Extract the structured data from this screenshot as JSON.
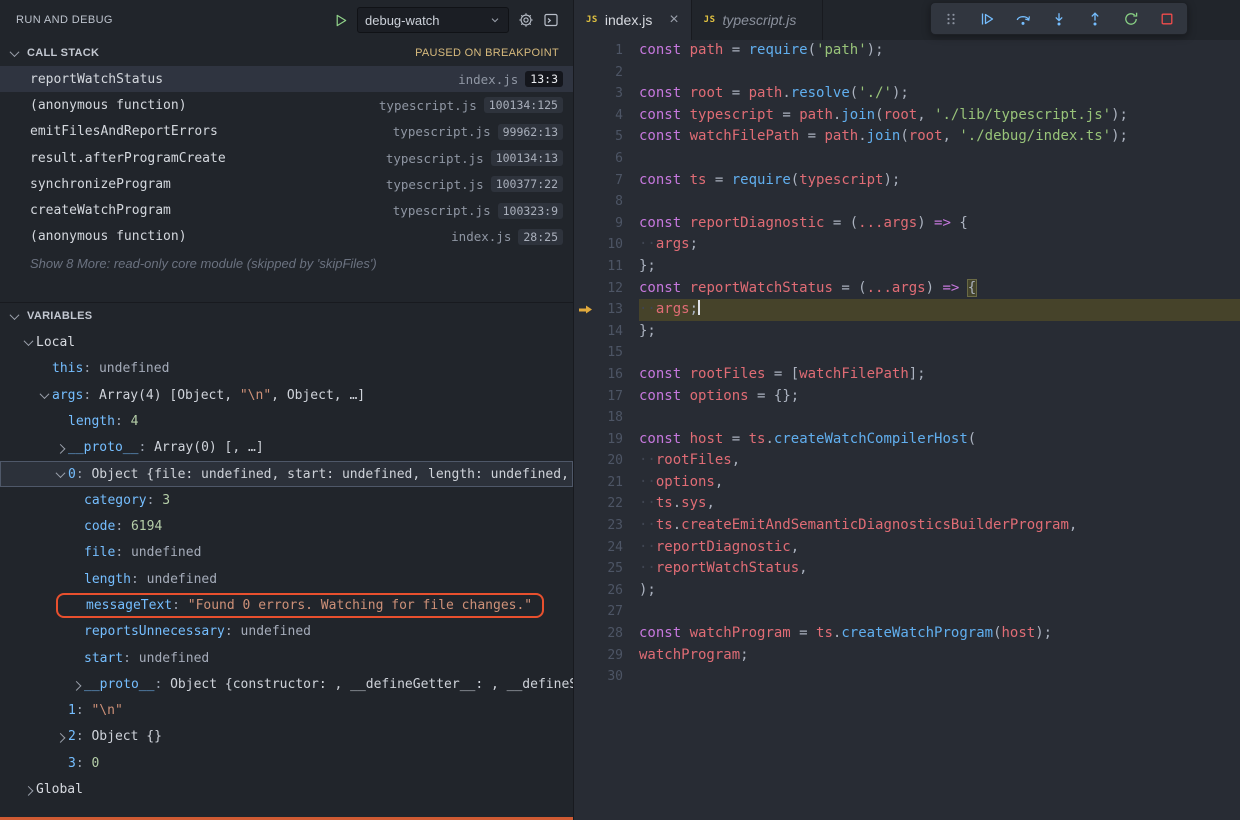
{
  "sidebar": {
    "title": "RUN AND DEBUG",
    "launch": {
      "config": "debug-watch",
      "icons": [
        "start-debug",
        "gear",
        "debug-console"
      ]
    },
    "call_stack": {
      "header": "CALL STACK",
      "status": "PAUSED ON BREAKPOINT",
      "frames": [
        {
          "name": "reportWatchStatus",
          "file": "index.js",
          "line": "13:3",
          "selected": true,
          "dark_badge": true
        },
        {
          "name": "(anonymous function)",
          "file": "typescript.js",
          "line": "100134:125"
        },
        {
          "name": "emitFilesAndReportErrors",
          "file": "typescript.js",
          "line": "99962:13"
        },
        {
          "name": "result.afterProgramCreate",
          "file": "typescript.js",
          "line": "100134:13"
        },
        {
          "name": "synchronizeProgram",
          "file": "typescript.js",
          "line": "100377:22"
        },
        {
          "name": "createWatchProgram",
          "file": "typescript.js",
          "line": "100323:9"
        },
        {
          "name": "(anonymous function)",
          "file": "index.js",
          "line": "28:25"
        }
      ],
      "more_text": "Show 8 More: read-only core module (skipped by 'skipFiles')"
    },
    "variables": {
      "header": "VARIABLES",
      "items": [
        {
          "depth": 1,
          "chevron": "down",
          "scope": "Local"
        },
        {
          "depth": 2,
          "chevron": "none",
          "name": "this",
          "value_parts": [
            [
              "undef",
              "undefined"
            ]
          ]
        },
        {
          "depth": 2,
          "chevron": "down",
          "name": "args",
          "value_parts": [
            [
              "plain",
              "Array(4) [Object, "
            ],
            [
              "str",
              "\"\\n\""
            ],
            [
              "plain",
              ", Object, …]"
            ]
          ]
        },
        {
          "depth": 3,
          "chevron": "none",
          "name": "length",
          "value_parts": [
            [
              "num",
              "4"
            ]
          ]
        },
        {
          "depth": 3,
          "chevron": "right",
          "name": "__proto__",
          "value_parts": [
            [
              "plain",
              "Array(0) [, …]"
            ]
          ]
        },
        {
          "depth": 3,
          "chevron": "down",
          "name": "0",
          "focused": true,
          "value_parts": [
            [
              "plain",
              "Object {file: undefined, start: undefined, length: undefined, …"
            ]
          ]
        },
        {
          "depth": 4,
          "chevron": "none",
          "name": "category",
          "value_parts": [
            [
              "num",
              "3"
            ]
          ]
        },
        {
          "depth": 4,
          "chevron": "none",
          "name": "code",
          "value_parts": [
            [
              "num",
              "6194"
            ]
          ]
        },
        {
          "depth": 4,
          "chevron": "none",
          "name": "file",
          "value_parts": [
            [
              "undef",
              "undefined"
            ]
          ]
        },
        {
          "depth": 4,
          "chevron": "none",
          "name": "length",
          "value_parts": [
            [
              "undef",
              "undefined"
            ]
          ]
        },
        {
          "depth": 4,
          "chevron": "none",
          "name": "messageText",
          "annotated": true,
          "value_parts": [
            [
              "str",
              "\"Found 0 errors. Watching for file changes.\""
            ]
          ]
        },
        {
          "depth": 4,
          "chevron": "none",
          "name": "reportsUnnecessary",
          "value_parts": [
            [
              "undef",
              "undefined"
            ]
          ]
        },
        {
          "depth": 4,
          "chevron": "none",
          "name": "start",
          "value_parts": [
            [
              "undef",
              "undefined"
            ]
          ]
        },
        {
          "depth": 4,
          "chevron": "right",
          "name": "__proto__",
          "value_parts": [
            [
              "plain",
              "Object {constructor: , __defineGetter__: , __defineS…"
            ]
          ]
        },
        {
          "depth": 3,
          "chevron": "none",
          "name": "1",
          "value_parts": [
            [
              "str",
              "\"\\n\""
            ]
          ]
        },
        {
          "depth": 3,
          "chevron": "right",
          "name": "2",
          "value_parts": [
            [
              "plain",
              "Object {}"
            ]
          ]
        },
        {
          "depth": 3,
          "chevron": "none",
          "name": "3",
          "value_parts": [
            [
              "num",
              "0"
            ]
          ]
        },
        {
          "depth": 1,
          "chevron": "right",
          "scope": "Global"
        }
      ]
    }
  },
  "editor": {
    "tabs": [
      {
        "label": "index.js",
        "icon": "js-file-icon",
        "active": true
      },
      {
        "label": "typescript.js",
        "icon": "js-file-icon",
        "preview": true
      }
    ],
    "debug_toolbar_icons": [
      "drag-handle",
      "continue",
      "step-over",
      "step-into",
      "step-out",
      "restart",
      "stop"
    ],
    "lines": [
      {
        "n": 1,
        "t": [
          [
            "k",
            "const"
          ],
          [
            "p",
            " "
          ],
          [
            "v",
            "path"
          ],
          [
            "p",
            " = "
          ],
          [
            "f",
            "require"
          ],
          [
            "p",
            "("
          ],
          [
            "s",
            "'path'"
          ],
          [
            "p",
            ");"
          ]
        ]
      },
      {
        "n": 2,
        "t": []
      },
      {
        "n": 3,
        "t": [
          [
            "k",
            "const"
          ],
          [
            "p",
            " "
          ],
          [
            "v",
            "root"
          ],
          [
            "p",
            " = "
          ],
          [
            "v",
            "path"
          ],
          [
            "p",
            "."
          ],
          [
            "f",
            "resolve"
          ],
          [
            "p",
            "("
          ],
          [
            "s",
            "'./'"
          ],
          [
            "p",
            ");"
          ]
        ]
      },
      {
        "n": 4,
        "t": [
          [
            "k",
            "const"
          ],
          [
            "p",
            " "
          ],
          [
            "v",
            "typescript"
          ],
          [
            "p",
            " = "
          ],
          [
            "v",
            "path"
          ],
          [
            "p",
            "."
          ],
          [
            "f",
            "join"
          ],
          [
            "p",
            "("
          ],
          [
            "v",
            "root"
          ],
          [
            "p",
            ", "
          ],
          [
            "s",
            "'./lib/typescript.js'"
          ],
          [
            "p",
            ");"
          ]
        ]
      },
      {
        "n": 5,
        "t": [
          [
            "k",
            "const"
          ],
          [
            "p",
            " "
          ],
          [
            "v",
            "watchFilePath"
          ],
          [
            "p",
            " = "
          ],
          [
            "v",
            "path"
          ],
          [
            "p",
            "."
          ],
          [
            "f",
            "join"
          ],
          [
            "p",
            "("
          ],
          [
            "v",
            "root"
          ],
          [
            "p",
            ", "
          ],
          [
            "s",
            "'./debug/index.ts'"
          ],
          [
            "p",
            ");"
          ]
        ]
      },
      {
        "n": 6,
        "t": []
      },
      {
        "n": 7,
        "t": [
          [
            "k",
            "const"
          ],
          [
            "p",
            " "
          ],
          [
            "v",
            "ts"
          ],
          [
            "p",
            " = "
          ],
          [
            "f",
            "require"
          ],
          [
            "p",
            "("
          ],
          [
            "v",
            "typescript"
          ],
          [
            "p",
            ");"
          ]
        ]
      },
      {
        "n": 8,
        "t": []
      },
      {
        "n": 9,
        "t": [
          [
            "k",
            "const"
          ],
          [
            "p",
            " "
          ],
          [
            "v",
            "reportDiagnostic"
          ],
          [
            "p",
            " = ("
          ],
          [
            "v",
            "...args"
          ],
          [
            "p",
            ") "
          ],
          [
            "a",
            "=>"
          ],
          [
            "p",
            " {"
          ]
        ]
      },
      {
        "n": 10,
        "t": [
          [
            "ws",
            "··"
          ],
          [
            "v",
            "args"
          ],
          [
            "p",
            ";"
          ]
        ]
      },
      {
        "n": 11,
        "t": [
          [
            "p",
            "};"
          ]
        ]
      },
      {
        "n": 12,
        "t": [
          [
            "k",
            "const"
          ],
          [
            "p",
            " "
          ],
          [
            "v",
            "reportWatchStatus"
          ],
          [
            "p",
            " = ("
          ],
          [
            "v",
            "...args"
          ],
          [
            "p",
            ") "
          ],
          [
            "a",
            "=>"
          ],
          [
            "p",
            " "
          ],
          [
            "bm",
            "{"
          ]
        ]
      },
      {
        "n": 13,
        "cur": true,
        "arrow": true,
        "caret": true,
        "t": [
          [
            "ws",
            "··"
          ],
          [
            "v",
            "args"
          ],
          [
            "p",
            ";"
          ]
        ]
      },
      {
        "n": 14,
        "t": [
          [
            "p",
            "};"
          ]
        ]
      },
      {
        "n": 15,
        "t": []
      },
      {
        "n": 16,
        "t": [
          [
            "k",
            "const"
          ],
          [
            "p",
            " "
          ],
          [
            "v",
            "rootFiles"
          ],
          [
            "p",
            " = ["
          ],
          [
            "v",
            "watchFilePath"
          ],
          [
            "p",
            "];"
          ]
        ]
      },
      {
        "n": 17,
        "t": [
          [
            "k",
            "const"
          ],
          [
            "p",
            " "
          ],
          [
            "v",
            "options"
          ],
          [
            "p",
            " = {};"
          ]
        ]
      },
      {
        "n": 18,
        "t": []
      },
      {
        "n": 19,
        "t": [
          [
            "k",
            "const"
          ],
          [
            "p",
            " "
          ],
          [
            "v",
            "host"
          ],
          [
            "p",
            " = "
          ],
          [
            "v",
            "ts"
          ],
          [
            "p",
            "."
          ],
          [
            "f",
            "createWatchCompilerHost"
          ],
          [
            "p",
            "("
          ]
        ]
      },
      {
        "n": 20,
        "t": [
          [
            "ws",
            "··"
          ],
          [
            "v",
            "rootFiles"
          ],
          [
            "p",
            ","
          ]
        ]
      },
      {
        "n": 21,
        "t": [
          [
            "ws",
            "··"
          ],
          [
            "v",
            "options"
          ],
          [
            "p",
            ","
          ]
        ]
      },
      {
        "n": 22,
        "t": [
          [
            "ws",
            "··"
          ],
          [
            "v",
            "ts"
          ],
          [
            "p",
            "."
          ],
          [
            "v",
            "sys"
          ],
          [
            "p",
            ","
          ]
        ]
      },
      {
        "n": 23,
        "t": [
          [
            "ws",
            "··"
          ],
          [
            "v",
            "ts"
          ],
          [
            "p",
            "."
          ],
          [
            "v",
            "createEmitAndSemanticDiagnosticsBuilderProgram"
          ],
          [
            "p",
            ","
          ]
        ]
      },
      {
        "n": 24,
        "t": [
          [
            "ws",
            "··"
          ],
          [
            "v",
            "reportDiagnostic"
          ],
          [
            "p",
            ","
          ]
        ]
      },
      {
        "n": 25,
        "t": [
          [
            "ws",
            "··"
          ],
          [
            "v",
            "reportWatchStatus"
          ],
          [
            "p",
            ","
          ]
        ]
      },
      {
        "n": 26,
        "t": [
          [
            "p",
            ");"
          ]
        ]
      },
      {
        "n": 27,
        "t": []
      },
      {
        "n": 28,
        "t": [
          [
            "k",
            "const"
          ],
          [
            "p",
            " "
          ],
          [
            "v",
            "watchProgram"
          ],
          [
            "p",
            " = "
          ],
          [
            "v",
            "ts"
          ],
          [
            "p",
            "."
          ],
          [
            "f",
            "createWatchProgram"
          ],
          [
            "p",
            "("
          ],
          [
            "v",
            "host"
          ],
          [
            "p",
            ");"
          ]
        ]
      },
      {
        "n": 29,
        "t": [
          [
            "v",
            "watchProgram"
          ],
          [
            "p",
            ";"
          ]
        ]
      },
      {
        "n": 30,
        "t": []
      }
    ]
  }
}
